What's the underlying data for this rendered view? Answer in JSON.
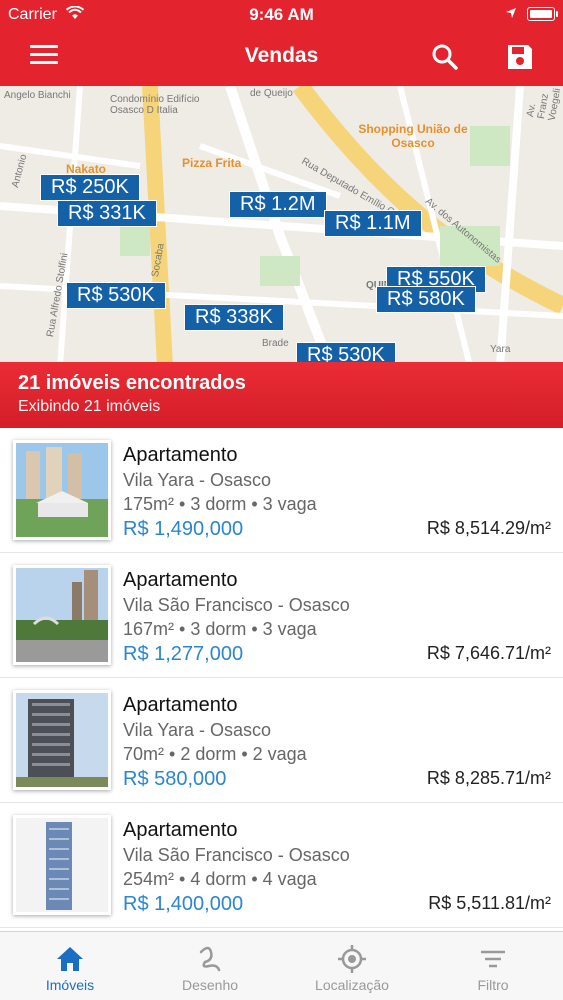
{
  "status_bar": {
    "carrier": "Carrier",
    "time": "9:46 AM"
  },
  "nav": {
    "title": "Vendas",
    "menu_icon": "hamburger-menu-icon",
    "search_icon": "search-icon",
    "save_icon": "floppy-disk-icon"
  },
  "map": {
    "street_labels": [
      "Angelo Bianchi",
      "Condomínio Edifício Osasco D Italia",
      "de Queijo",
      "Nakato",
      "Pizza Frita",
      "Shopping União de Osasco",
      "Av. Franz Voegeli",
      "Av. dos Autonomistas",
      "Rua Deputado Emílio Carlos",
      "Rua Alfredo Stolfini",
      "Socaba",
      "QUINT",
      "Brade",
      "Yara",
      "Antonio"
    ],
    "price_markers": [
      "R$ 250K",
      "R$ 331K",
      "R$ 1.2M",
      "R$ 1.1M",
      "R$ 530K",
      "R$ 338K",
      "R$ 550K",
      "R$ 580K",
      "R$ 530K"
    ]
  },
  "results": {
    "count_text": "21 imóveis encontrados",
    "showing_text": "Exibindo 21 imóveis"
  },
  "listings": [
    {
      "type": "Apartamento",
      "location": "Vila Yara - Osasco",
      "specs": "175m² • 3 dorm • 3 vaga",
      "price": "R$ 1,490,000",
      "price_per_m2": "R$ 8,514.29/m²"
    },
    {
      "type": "Apartamento",
      "location": "Vila São Francisco - Osasco",
      "specs": "167m² • 3 dorm • 3 vaga",
      "price": "R$ 1,277,000",
      "price_per_m2": "R$ 7,646.71/m²"
    },
    {
      "type": "Apartamento",
      "location": "Vila Yara - Osasco",
      "specs": "70m² • 2 dorm • 2 vaga",
      "price": "R$ 580,000",
      "price_per_m2": "R$ 8,285.71/m²"
    },
    {
      "type": "Apartamento",
      "location": "Vila São Francisco - Osasco",
      "specs": "254m² • 4 dorm • 4 vaga",
      "price": "R$ 1,400,000",
      "price_per_m2": "R$ 5,511.81/m²"
    }
  ],
  "tabs": [
    {
      "label": "Imóveis",
      "icon": "home-icon",
      "active": true
    },
    {
      "label": "Desenho",
      "icon": "draw-gesture-icon",
      "active": false
    },
    {
      "label": "Localização",
      "icon": "location-target-icon",
      "active": false
    },
    {
      "label": "Filtro",
      "icon": "filter-icon",
      "active": false
    }
  ],
  "colors": {
    "brand_red": "#e3232d",
    "marker_blue": "#1461a8",
    "price_blue": "#2a86d1",
    "active_tab": "#1a6fc4"
  }
}
